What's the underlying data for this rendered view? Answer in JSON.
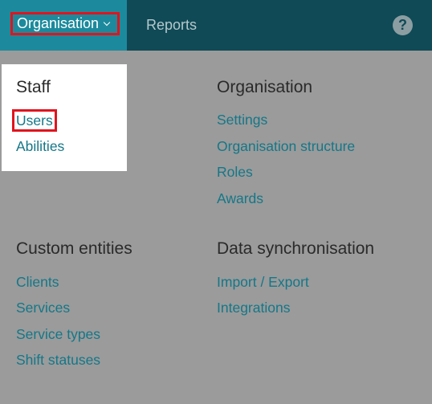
{
  "nav": {
    "organisation": "Organisation",
    "reports": "Reports",
    "help": "?"
  },
  "menu": {
    "staff": {
      "title": "Staff",
      "items": [
        "Users",
        "Abilities"
      ]
    },
    "organisation": {
      "title": "Organisation",
      "items": [
        "Settings",
        "Organisation structure",
        "Roles",
        "Awards"
      ]
    },
    "custom_entities": {
      "title": "Custom entities",
      "items": [
        "Clients",
        "Services",
        "Service types",
        "Shift statuses"
      ]
    },
    "data_sync": {
      "title": "Data synchronisation",
      "items": [
        "Import / Export",
        "Integrations"
      ]
    }
  },
  "colors": {
    "topbar": "#0f4a56",
    "active_nav": "#1c8a9c",
    "overlay": "#9b9b9b",
    "link": "#147788",
    "highlight": "#e0141e"
  }
}
